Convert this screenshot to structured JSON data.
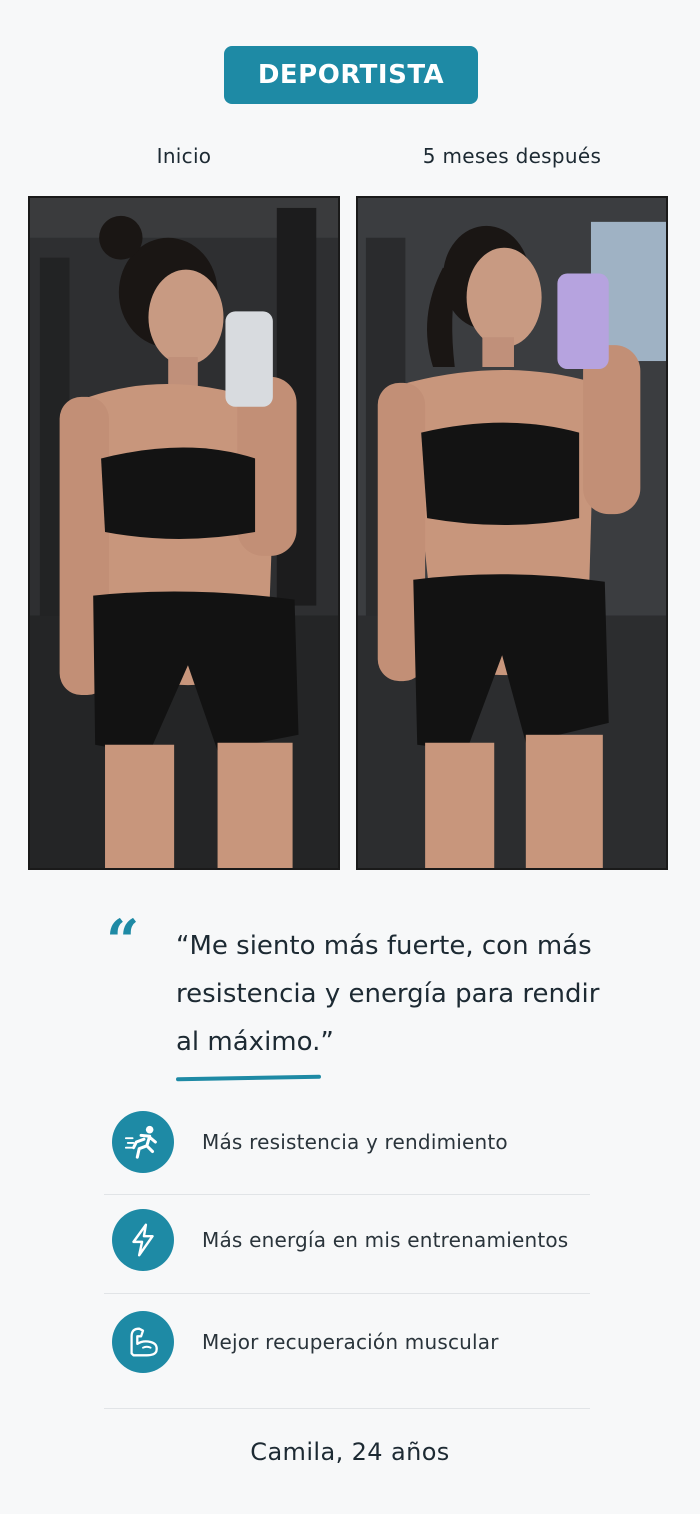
{
  "badge": {
    "label": "DEPORTISTA"
  },
  "photos": {
    "before_label": "Inicio",
    "after_label": "5 meses después"
  },
  "testimonial": {
    "quote": "“Me siento más fuerte, con más resistencia y energía para rendir al máximo.”",
    "author": "Camila, 24 años"
  },
  "benefits": [
    {
      "icon": "running-person-icon",
      "label": "Más resistencia y rendimiento"
    },
    {
      "icon": "lightning-bolt-icon",
      "label": "Más energía en mis entrenamientos"
    },
    {
      "icon": "flexed-arm-icon",
      "label": "Mejor recuperación muscular"
    }
  ],
  "colors": {
    "accent": "#1e8aa5",
    "text": "#1d2a33",
    "background": "#f7f8f9"
  }
}
